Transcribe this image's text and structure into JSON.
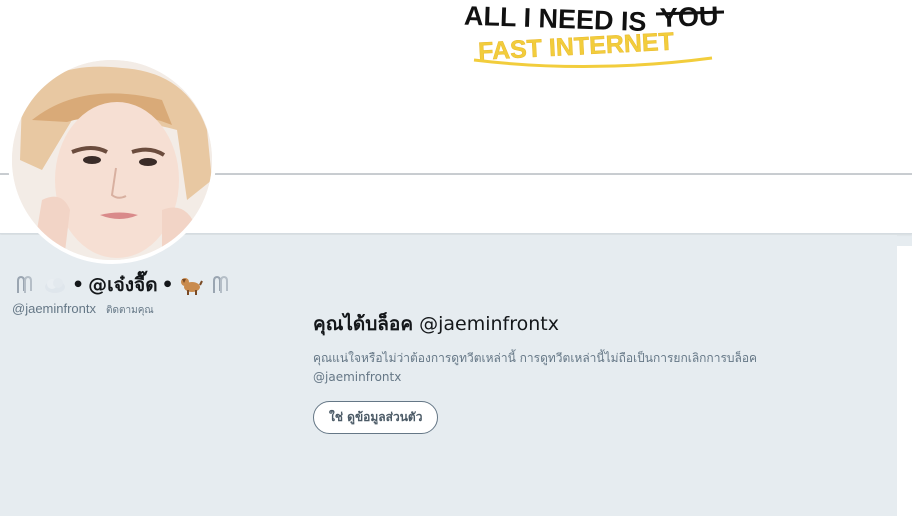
{
  "banner": {
    "line1": "ALL I NEED IS",
    "strike_word": "YOU",
    "line2": "FAST INTERNET"
  },
  "profile": {
    "display_name_text": "@เจ๋งจื๊ด",
    "separator": "•",
    "emojis": [
      "paperclips-icon",
      "cloud-icon",
      "dog-icon",
      "paperclips-icon"
    ],
    "handle": "@jaeminfrontx",
    "follows_you_badge": "ติดตามคุณ"
  },
  "blocked_notice": {
    "title_prefix": "คุณได้บล็อค",
    "title_handle": "@jaeminfrontx",
    "description": "คุณแน่ใจหรือไม่ว่าต้องการดูทวีตเหล่านี้ การดูทวีตเหล่านี้ไม่ถือเป็นการยกเลิกการบล็อค @jaeminfrontx",
    "button_label": "ใช่ ดูข้อมูลส่วนตัว"
  },
  "colors": {
    "page_bg": "#e6ecf0",
    "text_primary": "#14171a",
    "text_secondary": "#657786",
    "banner_yellow": "#f2cd3c"
  }
}
